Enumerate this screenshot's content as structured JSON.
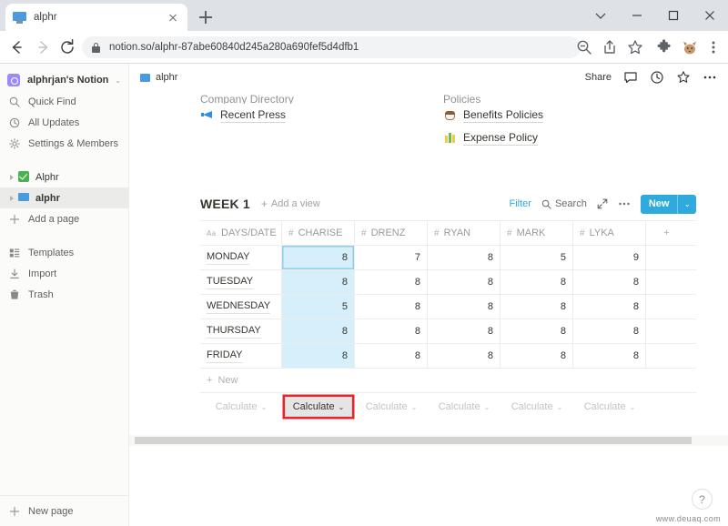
{
  "browser": {
    "tab": {
      "title": "alphr",
      "favicon": "monitor-icon",
      "close": "close-icon"
    },
    "new_tab": "new-tab-icon",
    "window_controls": [
      "chevron-down-icon",
      "minimize-icon",
      "maximize-icon",
      "close-icon"
    ],
    "nav": {
      "back": "back-arrow-icon",
      "forward": "forward-arrow-icon",
      "reload": "reload-icon"
    },
    "omnibox": {
      "lock": "lock-icon",
      "url": "notion.so/alphr-87abe60840d245a280a690fef5d4dfb1"
    },
    "toolbar_icons": [
      "zoom-out-icon",
      "share-icon",
      "bookmark-star-icon",
      "extensions-puzzle-icon",
      "profile-avatar-icon",
      "chrome-menu-icon"
    ]
  },
  "sidebar": {
    "workspace": {
      "name": "alphrjan's Notion",
      "chevron": "chevron-updown-icon"
    },
    "items": [
      {
        "label": "Quick Find",
        "icon": "search-icon"
      },
      {
        "label": "All Updates",
        "icon": "clock-icon"
      },
      {
        "label": "Settings & Members",
        "icon": "gear-icon"
      }
    ],
    "pages": [
      {
        "label": "Alphr",
        "emoji": "check-green",
        "selected": false
      },
      {
        "label": "alphr",
        "emoji": "blue-screen",
        "selected": true
      }
    ],
    "add_page": {
      "label": "Add a page",
      "icon": "plus-icon"
    },
    "tools": [
      {
        "label": "Templates",
        "icon": "templates-icon"
      },
      {
        "label": "Import",
        "icon": "import-icon"
      },
      {
        "label": "Trash",
        "icon": "trash-icon"
      }
    ],
    "footer": {
      "label": "New page",
      "icon": "plus-icon"
    }
  },
  "topbar": {
    "breadcrumb": "alphr",
    "share": "Share",
    "icons": [
      "comment-icon",
      "updates-clock-icon",
      "favorite-star-icon",
      "more-dots-icon"
    ]
  },
  "links": {
    "left": [
      {
        "label": "Recent Press",
        "emoji": "megaphone"
      }
    ],
    "right": [
      {
        "label": "Benefits Policies",
        "emoji": "coffee"
      },
      {
        "label": "Expense Policy",
        "emoji": "bar-chart"
      }
    ]
  },
  "database": {
    "title": "WEEK 1",
    "add_view": "Add a view",
    "filter": "Filter",
    "search": "Search",
    "expand_icon": "expand-icon",
    "more_icon": "more-dots-icon",
    "new_button": {
      "label": "New",
      "chevron": "chevron-down-icon"
    },
    "columns": [
      {
        "label": "DAYS/DATE",
        "icon": "title-text-icon",
        "type": "title"
      },
      {
        "label": "CHARISE",
        "icon": "number-hash-icon",
        "type": "number",
        "highlighted": true
      },
      {
        "label": "DRENZ",
        "icon": "number-hash-icon",
        "type": "number"
      },
      {
        "label": "RYAN",
        "icon": "number-hash-icon",
        "type": "number"
      },
      {
        "label": "MARK",
        "icon": "number-hash-icon",
        "type": "number"
      },
      {
        "label": "LYKA",
        "icon": "number-hash-icon",
        "type": "number"
      }
    ],
    "add_column": "+",
    "rows": [
      {
        "name": "MONDAY",
        "values": [
          "8",
          "7",
          "8",
          "5",
          "9"
        ]
      },
      {
        "name": "TUESDAY",
        "values": [
          "8",
          "8",
          "8",
          "8",
          "8"
        ]
      },
      {
        "name": "WEDNESDAY",
        "values": [
          "5",
          "8",
          "8",
          "8",
          "8"
        ]
      },
      {
        "name": "THURSDAY",
        "values": [
          "8",
          "8",
          "8",
          "8",
          "8"
        ]
      },
      {
        "name": "FRIDAY",
        "values": [
          "8",
          "8",
          "8",
          "8",
          "8"
        ]
      }
    ],
    "new_row": "New",
    "calculate_label": "Calculate",
    "calculate_cells": [
      {
        "label": "Calculate",
        "active": false
      },
      {
        "label": "Calculate",
        "active": true
      },
      {
        "label": "Calculate",
        "active": false
      },
      {
        "label": "Calculate",
        "active": false
      },
      {
        "label": "Calculate",
        "active": false
      },
      {
        "label": "Calculate",
        "active": false
      }
    ]
  },
  "help_button": "?",
  "watermark": "www.deuaq.com",
  "colors": {
    "accent_blue": "#2eaadc",
    "highlight_column": "#d7eefb",
    "annotation_red": "#e8232a",
    "chrome_tabstrip": "#dee1e6",
    "sidebar_bg": "#fbfbfa"
  },
  "chart_data": {
    "type": "table",
    "title": "WEEK 1",
    "categories": [
      "MONDAY",
      "TUESDAY",
      "WEDNESDAY",
      "THURSDAY",
      "FRIDAY"
    ],
    "series": [
      {
        "name": "CHARISE",
        "values": [
          8,
          8,
          5,
          8,
          8
        ]
      },
      {
        "name": "DRENZ",
        "values": [
          7,
          8,
          8,
          8,
          8
        ]
      },
      {
        "name": "RYAN",
        "values": [
          8,
          8,
          8,
          8,
          8
        ]
      },
      {
        "name": "MARK",
        "values": [
          5,
          8,
          8,
          8,
          8
        ]
      },
      {
        "name": "LYKA",
        "values": [
          9,
          8,
          8,
          8,
          8
        ]
      }
    ],
    "xlabel": "DAYS/DATE",
    "ylabel": ""
  }
}
